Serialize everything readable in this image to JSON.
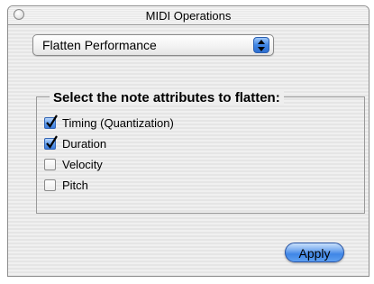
{
  "window": {
    "title": "MIDI Operations"
  },
  "operation_popup": {
    "selected": "Flatten Performance"
  },
  "attributes_group": {
    "title": "Select the note attributes to flatten:",
    "options": [
      {
        "label": "Timing (Quantization)",
        "checked": true
      },
      {
        "label": "Duration",
        "checked": true
      },
      {
        "label": "Velocity",
        "checked": false
      },
      {
        "label": "Pitch",
        "checked": false
      }
    ]
  },
  "buttons": {
    "apply": "Apply"
  },
  "colors": {
    "accent": "#3f86e6"
  },
  "icons": {
    "close": "close-icon",
    "popup_arrows": "up-down-arrows-icon",
    "check": "checkmark-icon"
  }
}
